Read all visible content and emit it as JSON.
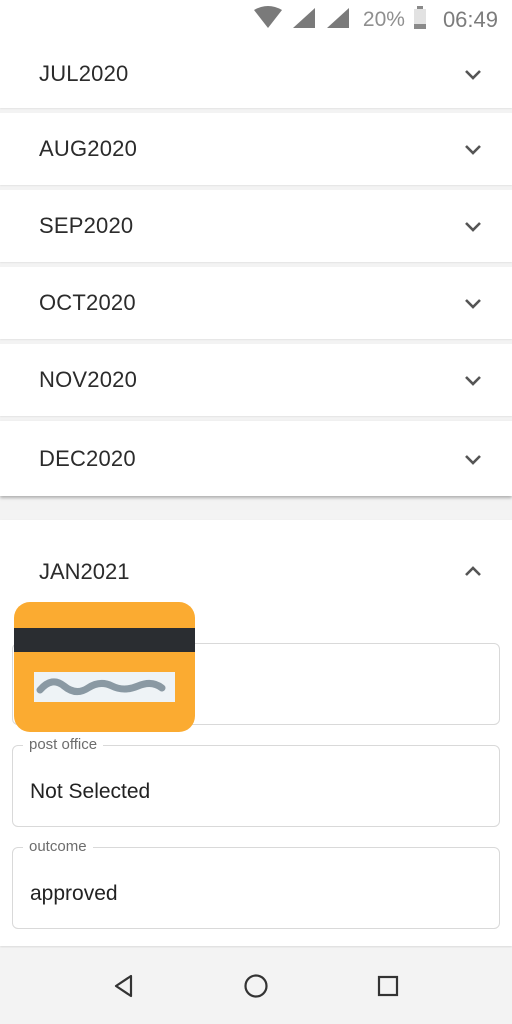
{
  "status_bar": {
    "battery_percent": "20%",
    "time": "06:49",
    "icons": [
      "wifi-icon",
      "signal-icon",
      "signal-icon",
      "battery-icon"
    ]
  },
  "months_collapsed": [
    {
      "label": "JUL2020",
      "icon": "chevron-down-icon"
    },
    {
      "label": "AUG2020",
      "icon": "chevron-down-icon"
    },
    {
      "label": "SEP2020",
      "icon": "chevron-down-icon"
    },
    {
      "label": "OCT2020",
      "icon": "chevron-down-icon"
    },
    {
      "label": "NOV2020",
      "icon": "chevron-down-icon"
    },
    {
      "label": "DEC2020",
      "icon": "chevron-down-icon"
    }
  ],
  "expanded": {
    "label": "JAN2021",
    "icon": "chevron-up-icon",
    "fields": [
      {
        "legend": "",
        "value": ""
      },
      {
        "legend": "post office",
        "value": "Not Selected"
      },
      {
        "legend": "outcome",
        "value": "approved"
      }
    ]
  },
  "overlay": {
    "icon": "credit-card-icon",
    "colors": {
      "body": "#fbab31",
      "stripe": "#2a2d31",
      "signature_strip": "#eef3f6",
      "squiggle": "#8a99a3"
    }
  },
  "nav_bar": {
    "icons": [
      "back-triangle-icon",
      "home-circle-icon",
      "recents-square-icon"
    ]
  }
}
